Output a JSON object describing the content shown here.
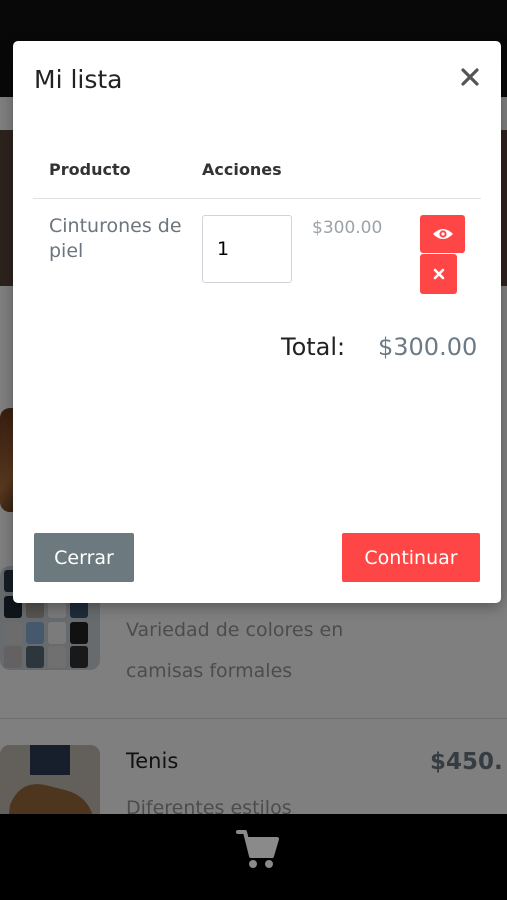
{
  "modal": {
    "title": "Mi lista",
    "columns": [
      "Producto",
      "Acciones"
    ],
    "items": [
      {
        "name": "Cinturones de piel",
        "quantity": "1",
        "price": "$300.00"
      }
    ],
    "total_label": "Total:",
    "total_value": "$300.00",
    "close_label": "Cerrar",
    "continue_label": "Continuar"
  },
  "background": {
    "products": [
      {
        "description": "Variedad de colores en camisas formales"
      },
      {
        "title": "Tenis",
        "price": "$450.",
        "description": "Diferentes estilos"
      }
    ]
  },
  "colors": {
    "accent": "#ff4646",
    "secondary": "#6c7a80",
    "overlay": "rgba(0,0,0,0.5)"
  }
}
